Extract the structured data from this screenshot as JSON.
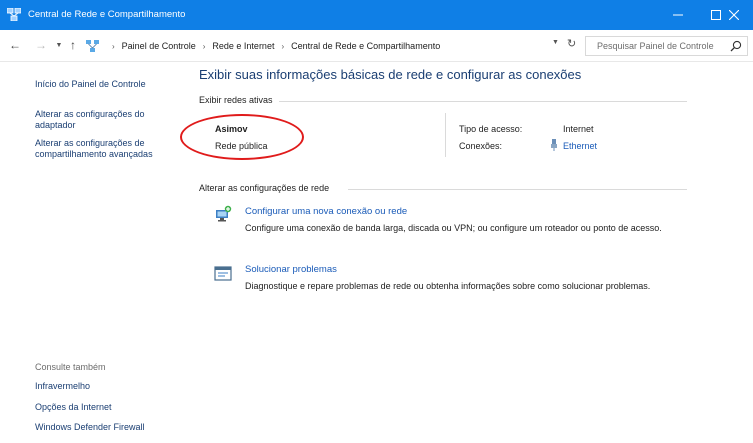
{
  "window": {
    "title": "Central de Rede e Compartilhamento",
    "colors": {
      "titlebar": "#0f7fe6",
      "link": "#1a5bb8",
      "heading": "#1a3e72",
      "annotation": "#e01b1b"
    }
  },
  "address": {
    "breadcrumbs": [
      "Painel de Controle",
      "Rede e Internet",
      "Central de Rede e Compartilhamento"
    ],
    "search_placeholder": "Pesquisar Painel de Controle"
  },
  "sidebar": {
    "home": "Início do Painel de Controle",
    "adapter": "Alterar as configurações do adaptador",
    "advanced": "Alterar as configurações de compartilhamento avançadas",
    "see_also_label": "Consulte também",
    "see_also": [
      "Infravermelho",
      "Opções da Internet",
      "Windows Defender Firewall"
    ]
  },
  "main": {
    "title": "Exibir suas informações básicas de rede e configurar as conexões",
    "active_networks_header": "Exibir redes ativas",
    "network": {
      "name": "Asimov",
      "type": "Rede pública",
      "access_label": "Tipo de acesso:",
      "access_value": "Internet",
      "connections_label": "Conexões:",
      "connections_value": "Ethernet"
    },
    "change_header": "Alterar as configurações de rede",
    "tasks": [
      {
        "label": "Configurar uma nova conexão ou rede",
        "description": "Configure uma conexão de banda larga, discada ou VPN; ou configure um roteador ou ponto de acesso.",
        "icon": "new-connection-icon"
      },
      {
        "label": "Solucionar problemas",
        "description": "Diagnostique e repare problemas de rede ou obtenha informações sobre como solucionar problemas.",
        "icon": "troubleshoot-icon"
      }
    ]
  }
}
